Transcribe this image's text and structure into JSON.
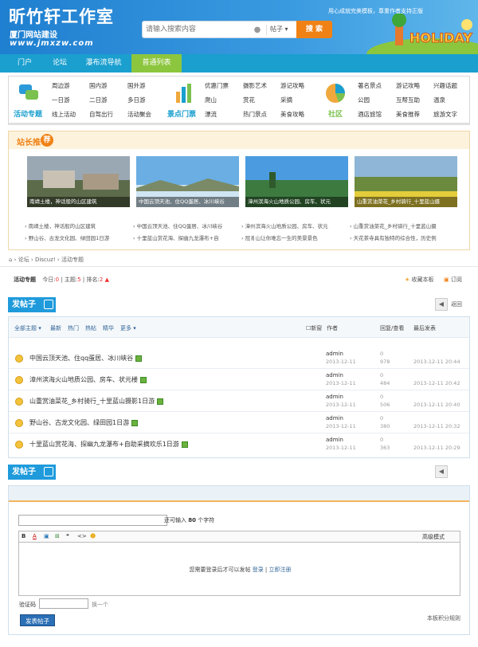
{
  "header": {
    "site_title": "昕竹轩工作室",
    "site_subtitle": "厦门网站建设",
    "site_url": "www.jmxzw.com",
    "slogan": "用心成就完美模板，尊重作者支持正版",
    "search_placeholder": "请输入搜索内容",
    "search_type": "帖子",
    "search_button": "搜 索",
    "holiday_text": "HOLIDAY"
  },
  "nav": {
    "items": [
      "门户",
      "论坛",
      "瀑布流导航",
      "普通列表"
    ],
    "active_index": 3
  },
  "categories": [
    {
      "label": "活动专题",
      "color": "#1a9fcf",
      "links": [
        "周边游",
        "国内游",
        "国外游",
        "一日游",
        "二日游",
        "多日游",
        "线上活动",
        "自驾出行",
        "活动聚会"
      ]
    },
    {
      "label": "景点门票",
      "color": "#1a9fcf",
      "links": [
        "优惠门票",
        "摄影艺术",
        "游记攻略",
        "爬山",
        "赏花",
        "采摘",
        "漂流",
        "热门景点",
        "美食攻略"
      ]
    },
    {
      "label": "社区",
      "color": "#8cc63e",
      "links": [
        "著名景点",
        "游记攻略",
        "兴趣话题",
        "公园",
        "互帮互助",
        "温泉",
        "酒店旅馆",
        "美食推荐",
        "旅游文字"
      ]
    }
  ],
  "recommend": {
    "title": "站长推",
    "badge": "荐",
    "photos": [
      {
        "caption": "南靖土楼，神话般的山区建筑"
      },
      {
        "caption": "中国云顶天池、住QQ蛋居、冰川峡谷"
      },
      {
        "caption": "漳州滨海火山地质公园、房车、状元"
      },
      {
        "caption": "山重赏油菜花_乡村骑行_十里蓝山摄"
      }
    ],
    "links": [
      [
        "南靖土楼，神话般的山区建筑",
        "野山谷、古龙文化园、绿田园1日游"
      ],
      [
        "中国云顶天池、住QQ蛋居、冰川峡谷",
        "十里蓝山赏花海、探幽九龙瀑布+自"
      ],
      [
        "漳州滨海火山地质公园、房车、状元",
        "冠豸山让你难忘一生的美景景色"
      ],
      [
        "山重赏油菜花_乡村骑行_十里蓝山摄",
        "天花茶寺具有独特的综合性，历史例"
      ]
    ]
  },
  "breadcrumb": [
    "论坛",
    "Discuz!",
    "活动专题"
  ],
  "forum": {
    "name": "活动专题",
    "today_label": "今日:",
    "today": "0",
    "topics_label": "主题:",
    "topics": "5",
    "rank_label": "排名:",
    "rank": "2",
    "favorite": "收藏本板",
    "subscribe": "订阅"
  },
  "post_button": "发帖子",
  "back_label": "返回",
  "table": {
    "filters": [
      "全部主题",
      "最新",
      "热门",
      "热帖",
      "精华",
      "更多"
    ],
    "new_label": "新窗",
    "col_author": "作者",
    "col_replies": "回复/查看",
    "col_last": "最后发表",
    "rows": [
      {
        "title": "中国云顶天池、住qq蛋居、冰川峡谷",
        "author": "admin",
        "date": "2013-12-11",
        "replies": "0",
        "views": "978",
        "last": "2013-12-11 20:44"
      },
      {
        "title": "漳州滨海火山地质公园、房车、状元楼",
        "author": "admin",
        "date": "2013-12-11",
        "replies": "0",
        "views": "484",
        "last": "2013-12-11 20:42"
      },
      {
        "title": "山重赏油菜花_乡村骑行_十里蓝山摄影1日游",
        "author": "admin",
        "date": "2013-12-11",
        "replies": "0",
        "views": "506",
        "last": "2013-12-11 20:40"
      },
      {
        "title": "野山谷、古龙文化园、绿田园1日游",
        "author": "admin",
        "date": "2013-12-11",
        "replies": "0",
        "views": "380",
        "last": "2013-12-11 20:32"
      },
      {
        "title": "十里蓝山赏花海、探幽九龙瀑布+自助采摘欢乐1日游",
        "author": "admin",
        "date": "2013-12-11",
        "replies": "0",
        "views": "363",
        "last": "2013-12-11 20:29"
      }
    ]
  },
  "editor": {
    "header_text": "快速发帖",
    "remain_prefix": "还可输入",
    "remain_count": "80",
    "remain_suffix": "个字符",
    "tools": [
      "B",
      "A",
      "▣",
      "⊞",
      "❝",
      "<>",
      "☻"
    ],
    "advanced": "高级模式",
    "login_tip": "您需要登录后才可以发帖",
    "login_link": "登录",
    "register_link": "立即注册",
    "captcha_label": "验证码",
    "captcha_refresh": "换一个",
    "submit": "发表帖子",
    "rules": "本板积分规则"
  }
}
